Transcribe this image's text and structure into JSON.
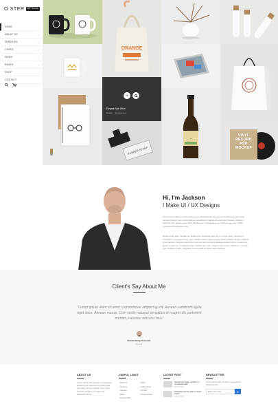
{
  "brand": {
    "logo_text": "O  STER",
    "badge": "WP Theme"
  },
  "menu": [
    {
      "label": "HOME"
    },
    {
      "label": "ABOUT US"
    },
    {
      "label": "SERVICES"
    },
    {
      "label": "CASES"
    },
    {
      "label": "NEWS"
    },
    {
      "label": "PAGES"
    },
    {
      "label": "SHOP"
    },
    {
      "label": "CONTACT"
    }
  ],
  "grid": {
    "hover": {
      "title": "Elegant Spin Wine",
      "cat1": "Design",
      "cat2": "Development"
    },
    "stamp_text": "RUBBER STAMP",
    "bag_text": "ORANGE",
    "record_text": "VINYL RECORD PSD MOCKUP"
  },
  "about": {
    "title": "Hi, I'm Jackson",
    "subtitle": "I Make UI / UX Designs",
    "p1": "Lorem ipsum dolor sit amet consectetur adipiscing elit. Aenean commodo ligula eget dolor. Aenean massa. Cum sociis natoque penatibus et magnis dis parturient montes, nascetur ridiculus mus. Donec quam felis, ultricies nec, pellentesque eu, pretium quis, sem. Nulla consequat massa quis enim.",
    "p2": "Donec pede justo, fringilla vel, aliquet nec, vulputate eget, arcu. In enim justo, rhoncus ut, imperdiet a, venenatis vitae, justo. Nullam dictum felis eu pede mollis pretium. Integer tincidunt. Cras dapibus. Vivamus elementum semper nisi. Aenean vulputate eleifend tellus. Aenean leo ligula, porttitor eu, consequat vitae, eleifend ac, enim. Aliquam lorem ante, dapibus in, viverra quis, feugiat a, tellus. Phasellus viverra nulla ut metus varius laoreet."
  },
  "testimonials": {
    "title": "Client's Say About Me",
    "quote": "\"Lorem ipsum dolor sit amet, consectetuer adipiscing elit. Aenean commodo ligula eget dolor. Aenean massa. Cum sociis natoque penatibus et magnis dis parturient montes, nascetur ridiculus mus\"",
    "name": "Brandenburg Alexander",
    "role": "Director"
  },
  "footer": {
    "about_title": "ABOUT US",
    "about_text": "Lorem ipsum dolor sit amet, consectetuer adipiscing elit. Aenean commodo ligula eget dolor. Aenean massa. Cum sociis natoque penatibus et magnis dis parturient montes.",
    "links_title": "USEFUL LINKS",
    "links": [
      "About us",
      "Team",
      "Services",
      "Latest News",
      "Careers",
      "Contact",
      "News",
      "Privacy Policy",
      "Testimonials"
    ],
    "posts_title": "LATEST POST",
    "posts": [
      {
        "title": "Aenean leo ligula, porttitor eu consequat vitae",
        "date": "28 Nov 2016"
      },
      {
        "title": "Phasellus viverra nulla ut metus varius",
        "date": "28 Nov 2016"
      }
    ],
    "news_title": "NEWSLETTER",
    "news_desc": "Lorem ipsum dolor sit amet, consectetuer adipiscing elit.",
    "news_placeholder": "Enter your email",
    "news_btn": "➤"
  }
}
